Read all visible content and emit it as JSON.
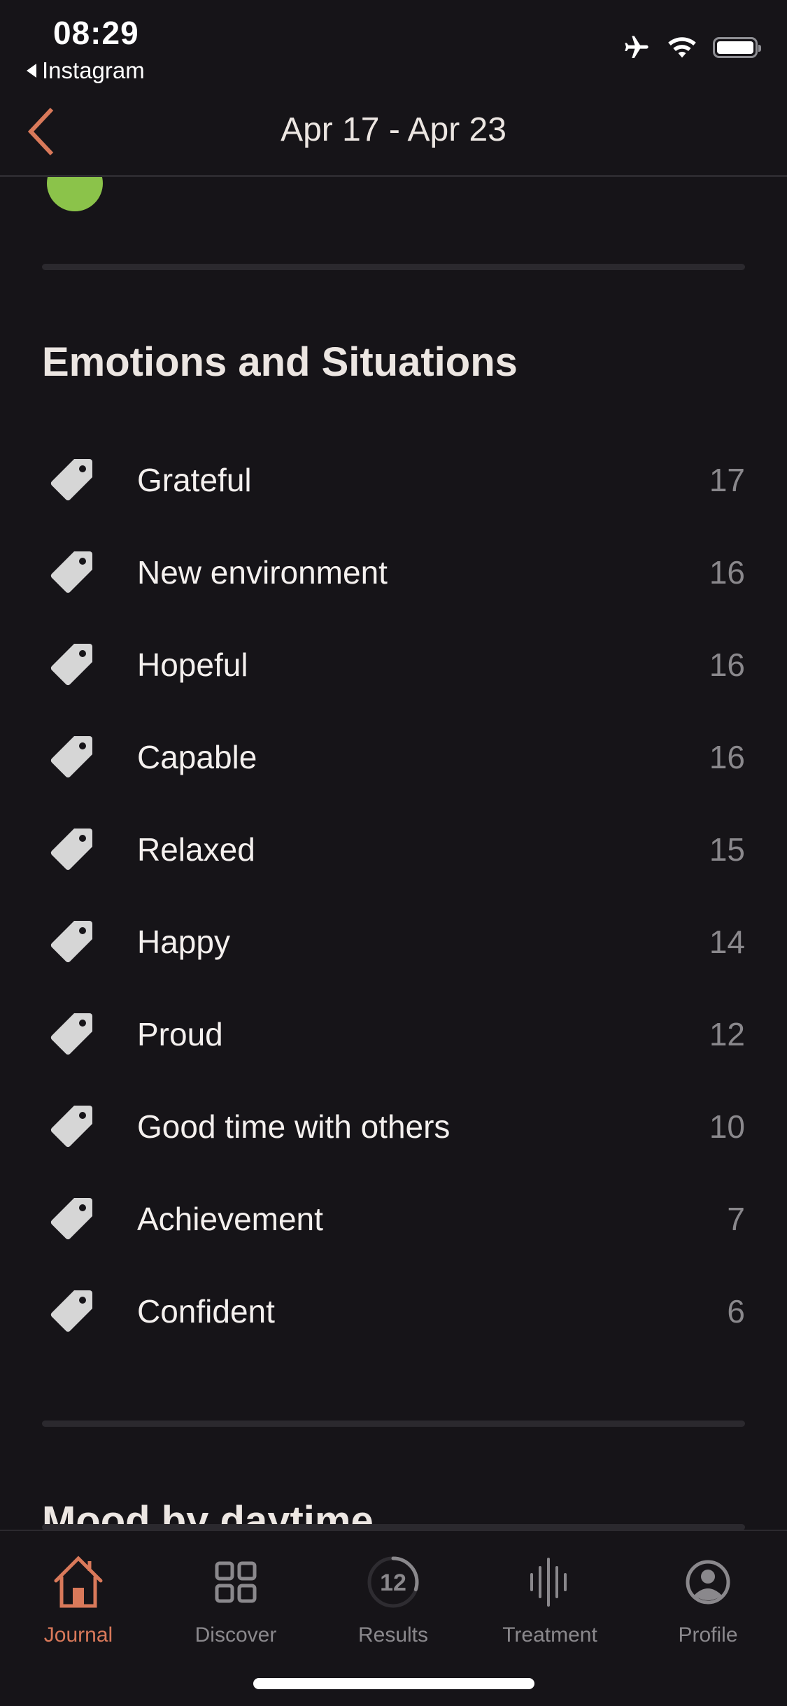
{
  "status_bar": {
    "time": "08:29",
    "back_app": "Instagram",
    "icons": [
      "airplane-icon",
      "wifi-icon",
      "battery-icon"
    ]
  },
  "nav": {
    "title": "Apr 17 - Apr 23",
    "back_icon": "chevron-left-icon",
    "accent_color": "#d9795a"
  },
  "emotions": {
    "title": "Emotions and Situations",
    "items": [
      {
        "label": "Grateful",
        "count": "17"
      },
      {
        "label": "New environment",
        "count": "16"
      },
      {
        "label": "Hopeful",
        "count": "16"
      },
      {
        "label": "Capable",
        "count": "16"
      },
      {
        "label": "Relaxed",
        "count": "15"
      },
      {
        "label": "Happy",
        "count": "14"
      },
      {
        "label": "Proud",
        "count": "12"
      },
      {
        "label": "Good time with others",
        "count": "10"
      },
      {
        "label": "Achievement",
        "count": "7"
      },
      {
        "label": "Confident",
        "count": "6"
      }
    ]
  },
  "next_section": {
    "title": "Mood by daytime"
  },
  "tab_bar": {
    "tabs": [
      {
        "label": "Journal",
        "icon": "home-icon",
        "active": true
      },
      {
        "label": "Discover",
        "icon": "grid-icon",
        "active": false
      },
      {
        "label": "Results",
        "icon": "results-ring-icon",
        "badge": "12",
        "progress": 0.3,
        "active": false
      },
      {
        "label": "Treatment",
        "icon": "soundwave-icon",
        "active": false
      },
      {
        "label": "Profile",
        "icon": "profile-icon",
        "active": false
      }
    ]
  }
}
